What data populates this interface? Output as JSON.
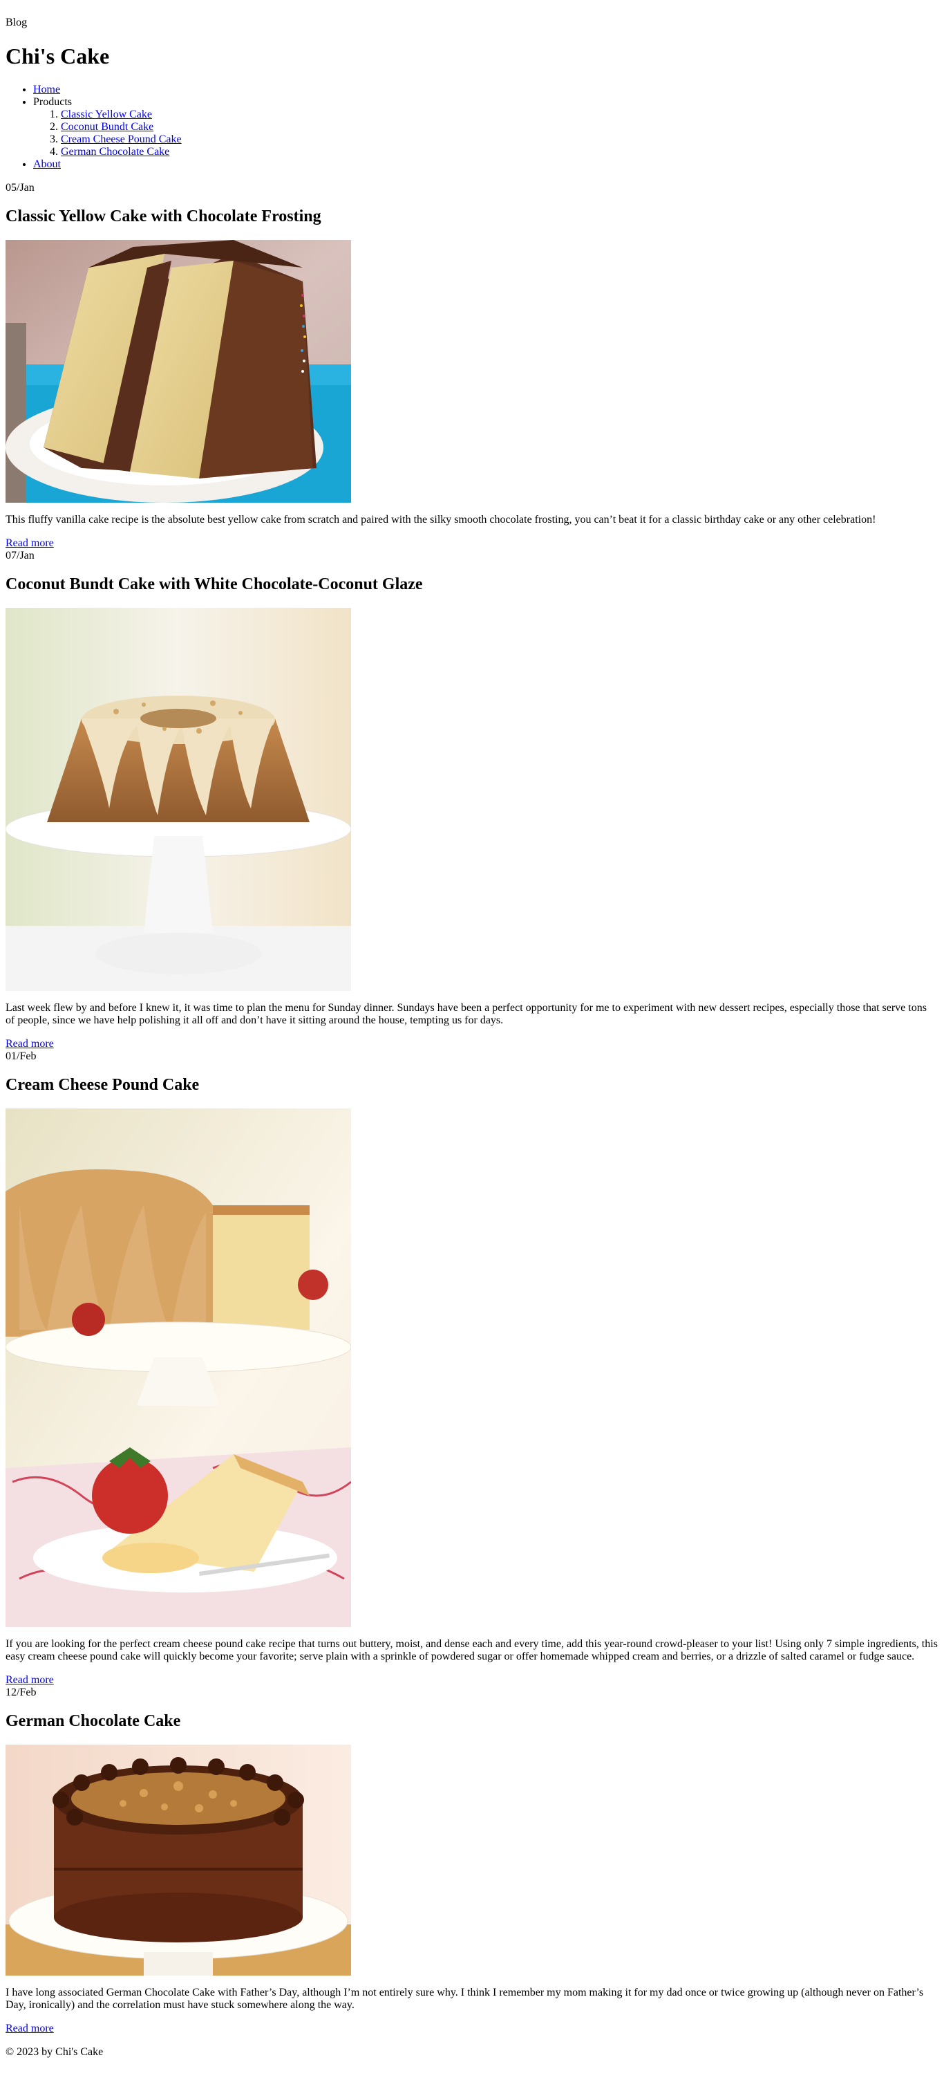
{
  "header": {
    "blog_label": "Blog",
    "site_title": "Chi's Cake"
  },
  "nav": {
    "home": "Home",
    "products": "Products",
    "product_items": [
      "Classic Yellow Cake",
      "Coconut Bundt Cake",
      "Cream Cheese Pound Cake",
      "German Chocolate Cake"
    ],
    "about": "About"
  },
  "posts": [
    {
      "date": "05/Jan",
      "title": "Classic Yellow Cake with Chocolate Frosting",
      "image_subject": "slice of yellow layer cake with chocolate frosting on white plate",
      "excerpt": "This fluffy vanilla cake recipe is the absolute best yellow cake from scratch and paired with the silky smooth chocolate frosting, you can’t beat it for a classic birthday cake or any other celebration!",
      "read_more": "Read more"
    },
    {
      "date": "07/Jan",
      "title": "Coconut Bundt Cake with White Chocolate-Coconut Glaze",
      "image_subject": "coconut bundt cake with white glaze on a white cake stand",
      "excerpt": "Last week flew by and before I knew it, it was time to plan the menu for Sunday dinner. Sundays have been a perfect opportunity for me to experiment with new dessert recipes, especially those that serve tons of people, since we have help polishing it all off and don’t have it sitting around the house, tempting us for days.",
      "read_more": "Read more"
    },
    {
      "date": "01/Feb",
      "title": "Cream Cheese Pound Cake",
      "image_subject": "cream cheese pound cake on cake stand with strawberries and a slice on a plate",
      "excerpt": "If you are looking for the perfect cream cheese pound cake recipe that turns out buttery, moist, and dense each and every time, add this year-round crowd-pleaser to your list! Using only 7 simple ingredients, this easy cream cheese pound cake will quickly become your favorite; serve plain with a sprinkle of powdered sugar or offer homemade whipped cream and berries, or a drizzle of salted caramel or fudge sauce.",
      "read_more": "Read more"
    },
    {
      "date": "12/Feb",
      "title": "German Chocolate Cake",
      "image_subject": "german chocolate cake with coconut pecan topping on white cake stand",
      "excerpt": "I have long associated German Chocolate Cake with Father’s Day, although I’m not entirely sure why. I think I remember my mom making it for my dad once or twice growing up (although never on Father’s Day, ironically) and the correlation must have stuck somewhere along the way.",
      "read_more": "Read more"
    }
  ],
  "footer": {
    "copyright": "© 2023 by Chi's Cake"
  }
}
